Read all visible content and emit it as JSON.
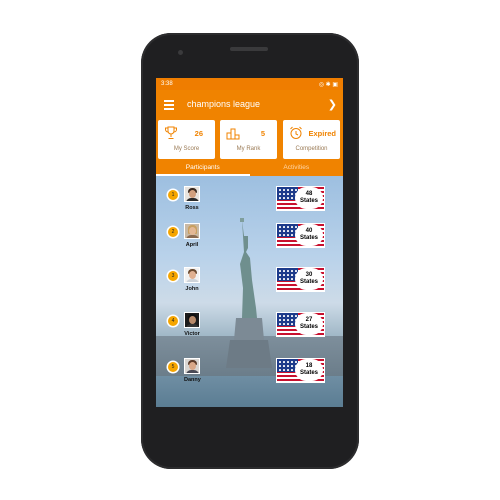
{
  "status_bar": {
    "time": "3:38",
    "right_icons": "◎ ✱ ▣"
  },
  "app_bar": {
    "title": "champions league"
  },
  "cards": [
    {
      "value": "26",
      "label": "My Score",
      "icon": "trophy-icon"
    },
    {
      "value": "5",
      "label": "My Rank",
      "icon": "podium-icon"
    },
    {
      "value": "Expired",
      "label": "Competition",
      "icon": "alarm-clock-icon"
    }
  ],
  "tabs": [
    {
      "label": "Participants",
      "active": true
    },
    {
      "label": "Activities",
      "active": false
    }
  ],
  "participants": [
    {
      "rank": "1",
      "name": "Ross",
      "count": "48",
      "unit": "States"
    },
    {
      "rank": "2",
      "name": "April",
      "count": "40",
      "unit": "States"
    },
    {
      "rank": "3",
      "name": "John",
      "count": "30",
      "unit": "States"
    },
    {
      "rank": "4",
      "name": "Victor",
      "count": "27",
      "unit": "States"
    },
    {
      "rank": "5",
      "name": "Danny",
      "count": "18",
      "unit": "States"
    }
  ],
  "colors": {
    "accent": "#f08300",
    "badge": "#f5a500"
  }
}
